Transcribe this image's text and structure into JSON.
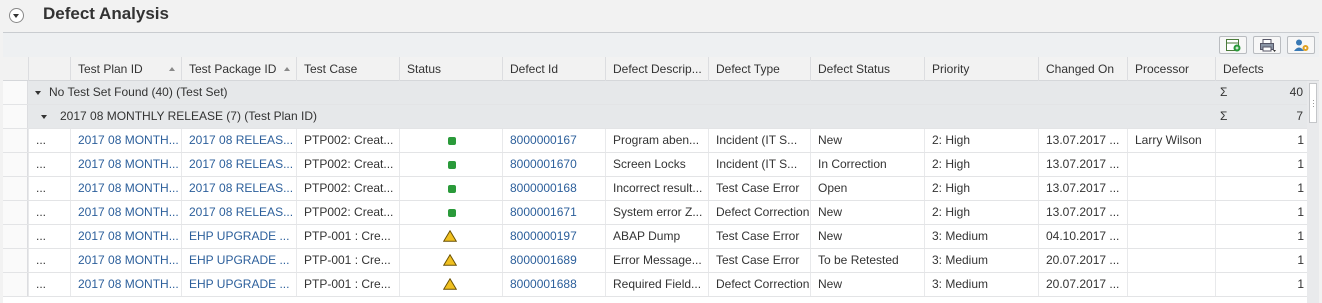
{
  "header": {
    "title": "Defect Analysis"
  },
  "toolbar": {
    "buttons": [
      {
        "name": "export-excel-button",
        "icon": "excel-export-icon"
      },
      {
        "name": "print-menu-button",
        "icon": "print-icon"
      },
      {
        "name": "personalize-button",
        "icon": "settings-person-icon"
      }
    ]
  },
  "columns": [
    {
      "label": "Test Plan ID",
      "sorted": true
    },
    {
      "label": "Test Package ID",
      "sorted": true
    },
    {
      "label": "Test Case",
      "sorted": false
    },
    {
      "label": "Status",
      "sorted": false
    },
    {
      "label": "Defect Id",
      "sorted": false
    },
    {
      "label": "Defect Descrip...",
      "sorted": false
    },
    {
      "label": "Defect Type",
      "sorted": false
    },
    {
      "label": "Defect Status",
      "sorted": false
    },
    {
      "label": "Priority",
      "sorted": false
    },
    {
      "label": "Changed On",
      "sorted": false
    },
    {
      "label": "Processor",
      "sorted": false
    },
    {
      "label": "Defects",
      "sorted": false
    }
  ],
  "groups": [
    {
      "label": "No Test Set Found (40) (Test Set)",
      "sum_symbol": "Σ",
      "total": "40"
    },
    {
      "label": "2017 08 MONTHLY RELEASE (7) (Test Plan ID)",
      "sum_symbol": "Σ",
      "total": "7"
    }
  ],
  "rows": [
    {
      "menu": "...",
      "plan": "2017 08 MONTH...",
      "package": "2017 08 RELEAS...",
      "testcase": "PTP002: Creat...",
      "status": "green",
      "defect_id": "8000000167",
      "desc": "Program aben...",
      "type": "Incident  (IT S...",
      "defect_status": "New",
      "priority": "2: High",
      "changed": "13.07.2017 ...",
      "processor": "Larry Wilson",
      "defects": "1"
    },
    {
      "menu": "...",
      "plan": "2017 08 MONTH...",
      "package": "2017 08 RELEAS...",
      "testcase": "PTP002: Creat...",
      "status": "green",
      "defect_id": "8000001670",
      "desc": "Screen Locks",
      "type": "Incident  (IT S...",
      "defect_status": "In Correction",
      "priority": "2: High",
      "changed": "13.07.2017 ...",
      "processor": "",
      "defects": "1"
    },
    {
      "menu": "...",
      "plan": "2017 08 MONTH...",
      "package": "2017 08 RELEAS...",
      "testcase": "PTP002: Creat...",
      "status": "green",
      "defect_id": "8000000168",
      "desc": "Incorrect result...",
      "type": "Test Case Error",
      "defect_status": "Open",
      "priority": "2: High",
      "changed": "13.07.2017 ...",
      "processor": "",
      "defects": "1"
    },
    {
      "menu": "...",
      "plan": "2017 08 MONTH...",
      "package": "2017 08 RELEAS...",
      "testcase": "PTP002: Creat...",
      "status": "green",
      "defect_id": "8000001671",
      "desc": "System error Z...",
      "type": "Defect Correction",
      "defect_status": "New",
      "priority": "2: High",
      "changed": "13.07.2017 ...",
      "processor": "",
      "defects": "1"
    },
    {
      "menu": "...",
      "plan": "2017 08 MONTH...",
      "package": "EHP UPGRADE ...",
      "testcase": "PTP-001 : Cre...",
      "status": "warning",
      "defect_id": "8000000197",
      "desc": "ABAP Dump",
      "type": "Test Case Error",
      "defect_status": "New",
      "priority": "3: Medium",
      "changed": "04.10.2017 ...",
      "processor": "",
      "defects": "1"
    },
    {
      "menu": "...",
      "plan": "2017 08 MONTH...",
      "package": "EHP UPGRADE ...",
      "testcase": "PTP-001 : Cre...",
      "status": "warning",
      "defect_id": "8000001689",
      "desc": "Error Message...",
      "type": "Test Case Error",
      "defect_status": "To be Retested",
      "priority": "3: Medium",
      "changed": "20.07.2017 ...",
      "processor": "",
      "defects": "1"
    },
    {
      "menu": "...",
      "plan": "2017 08 MONTH...",
      "package": "EHP UPGRADE ...",
      "testcase": "PTP-001 : Cre...",
      "status": "warning",
      "defect_id": "8000001688",
      "desc": "Required Field...",
      "type": "Defect Correction",
      "defect_status": "New",
      "priority": "3: Medium",
      "changed": "20.07.2017 ...",
      "processor": "",
      "defects": "1"
    }
  ],
  "colors": {
    "link": "#2c5f9b",
    "status_green": "#2a9a3a",
    "status_warning": "#f0c020"
  }
}
